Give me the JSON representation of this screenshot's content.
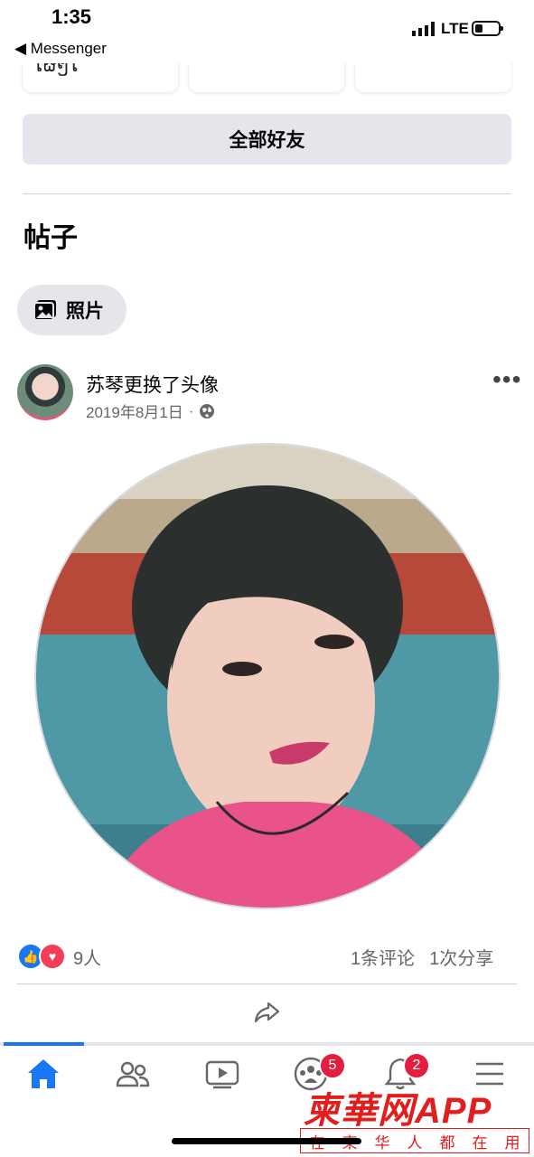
{
  "status_bar": {
    "time": "1:35",
    "back_label": "◀ Messenger",
    "network": "LTE"
  },
  "friends": {
    "cards": [
      {
        "name": "ໃຜໆໃ"
      },
      {
        "name": ""
      },
      {
        "name": ""
      }
    ],
    "all_friends_label": "全部好友"
  },
  "posts": {
    "section_title": "帖子",
    "photos_label": "照片"
  },
  "post": {
    "author_action": "苏琴更换了头像",
    "date": "2019年8月1日",
    "audience_icon": "globe-icon",
    "more_icon": "more-icon",
    "reaction_count": "9人",
    "comments": "1条评论",
    "shares": "1次分享"
  },
  "tabbar": {
    "items": [
      {
        "icon": "home-icon",
        "active": true
      },
      {
        "icon": "friends-icon"
      },
      {
        "icon": "watch-icon"
      },
      {
        "icon": "groups-icon",
        "badge": "5"
      },
      {
        "icon": "notifications-icon",
        "badge": "2"
      },
      {
        "icon": "menu-icon"
      }
    ]
  },
  "watermark": {
    "title": "柬華网APP",
    "subtitle": [
      "在",
      "柬",
      "华",
      "人",
      "都",
      "在",
      "用"
    ]
  },
  "colors": {
    "accent": "#1877f2",
    "badge": "#e41e3f",
    "watermark": "#e11d1d"
  }
}
